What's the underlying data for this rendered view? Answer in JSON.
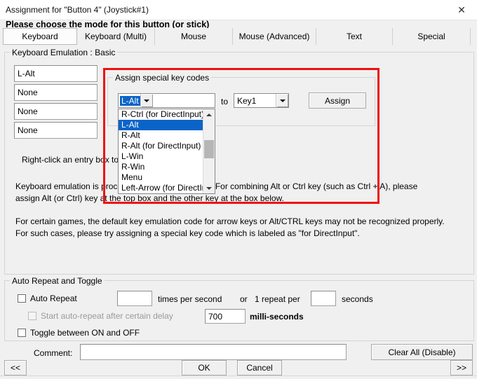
{
  "window": {
    "title": "Assignment for \"Button 4\" (Joystick#1)",
    "close_icon": "close-icon"
  },
  "prompt": "Please choose the mode for this button (or stick)",
  "tabs": [
    {
      "label": "Keyboard",
      "selected": true
    },
    {
      "label": "Keyboard (Multi)",
      "selected": false
    },
    {
      "label": "Mouse",
      "selected": false
    },
    {
      "label": "Mouse (Advanced)",
      "selected": false
    },
    {
      "label": "Text",
      "selected": false
    },
    {
      "label": "Special",
      "selected": false
    }
  ],
  "keyboard_basic": {
    "group_title": "Keyboard Emulation : Basic",
    "entries": [
      {
        "value": "L-Alt"
      },
      {
        "value": "None"
      },
      {
        "value": "None"
      },
      {
        "value": "None"
      }
    ],
    "paragraphs": {
      "right_click": "Right-click an entry box to assign special keys.",
      "emulation_line1": "Keyboard emulation is processed from top to bottom.  For combining Alt or Ctrl key (such as Ctrl + A), please",
      "emulation_line2": "assign Alt (or Ctrl) key at the top box and the other key at the box below.",
      "games_line1": "For certain games, the default key emulation code for arrow keys or Alt/CTRL keys may not be recognized properly.",
      "games_line2": "For such cases, please try assigning a special key code which is labeled as \"for DirectInput\"."
    }
  },
  "special_keys": {
    "group_title": "Assign special key codes",
    "source_combo_value": "L-Alt",
    "to_label": "to",
    "target_combo_value": "Key1",
    "assign_button": "Assign",
    "dropdown_options": [
      "R-Ctrl (for DirectInput)",
      "L-Alt",
      "R-Alt",
      "R-Alt (for DirectInput)",
      "L-Win",
      "R-Win",
      "Menu",
      "Left-Arrow (for DirectInp"
    ],
    "dropdown_selected_index": 1,
    "scroll_up_icon": "chevron-up-icon",
    "scroll_down_icon": "chevron-down-icon",
    "dropdown_arrow_icon": "chevron-down-icon"
  },
  "auto_repeat": {
    "group_title": "Auto Repeat and Toggle",
    "auto_repeat_label": "Auto Repeat",
    "auto_repeat_checked": false,
    "times_value": "",
    "times_label": "times per second",
    "or_label": "or",
    "one_repeat_label": "1 repeat per",
    "seconds_value": "",
    "seconds_label": "seconds",
    "delay_label": "Start auto-repeat after certain delay",
    "delay_checked": false,
    "delay_value": "700",
    "delay_units": "milli-seconds",
    "toggle_label": "Toggle between ON and OFF",
    "toggle_checked": false
  },
  "footer": {
    "comment_label": "Comment:",
    "comment_value": "",
    "clear_all_button": "Clear All (Disable)",
    "prev_button": "<<",
    "ok_button": "OK",
    "cancel_button": "Cancel",
    "next_button": ">>"
  },
  "colors": {
    "highlight": "#0a64c8",
    "annotation": "#ee1111",
    "dialog_bg": "#f0f0f0"
  }
}
